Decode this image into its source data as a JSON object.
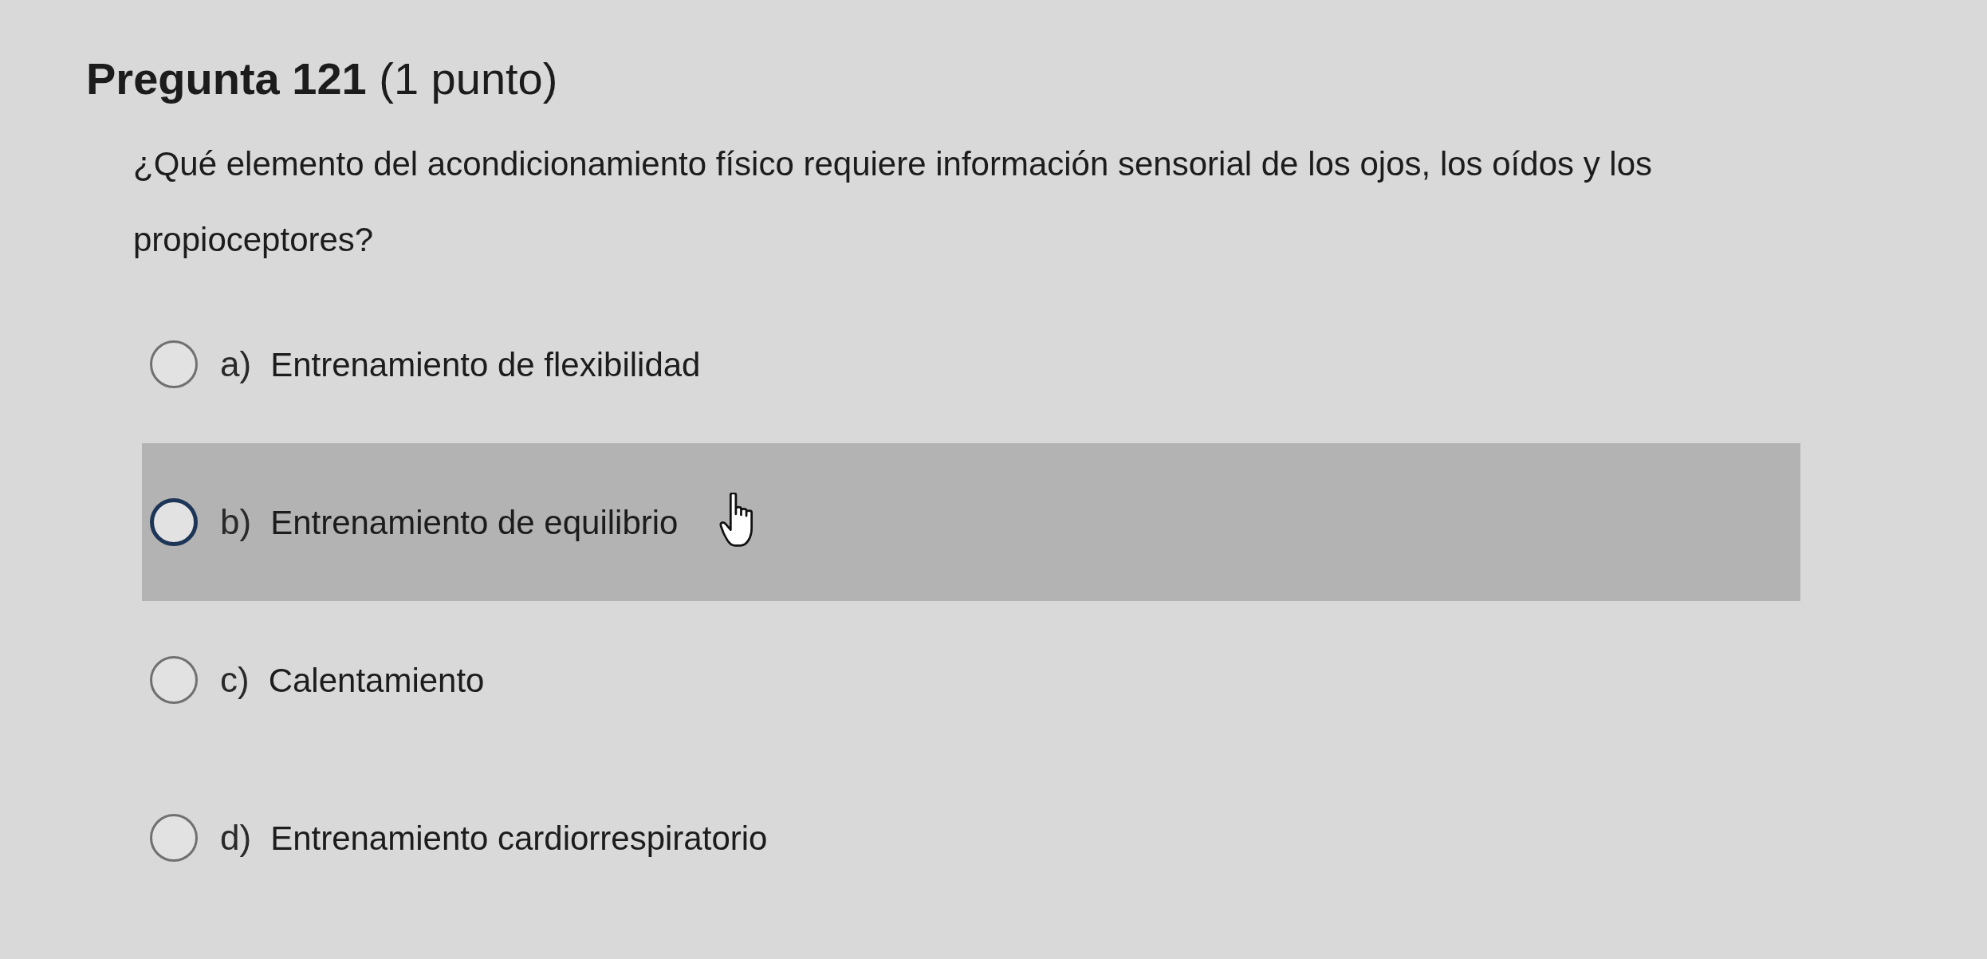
{
  "title": "**Pregunta 121** (1 punto)",
  "question": "¿Qué elemento del acondicionamiento físico requiere información sensorial de los ojos, los oídos y los propioceptores?",
  "options": [
    {
      "letter": "a)",
      "text": "Entrenamiento de flexibilidad",
      "selected": false,
      "hovered": false
    },
    {
      "letter": "b)",
      "text": "Entrenamiento de equilibrio",
      "selected": false,
      "hovered": true
    },
    {
      "letter": "c)",
      "text": "Calentamiento",
      "selected": false,
      "hovered": false
    },
    {
      "letter": "d)",
      "text": "Entrenamiento cardiorrespiratorio",
      "selected": false,
      "hovered": false
    }
  ]
}
